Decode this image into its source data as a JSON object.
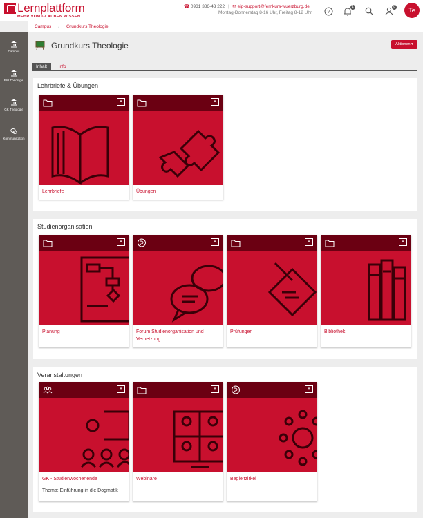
{
  "header": {
    "logo_title": "Lernplattform",
    "logo_subtitle": "MEHR VOM GLAUBEN WISSEN",
    "phone": "0931 386-43 222",
    "email": "eip-support@fernkurs-wuerzburg.de",
    "hours": "Montag-Donnerstag 8-16 Uhr, Freitag 8-12 Uhr",
    "notification_count": "1",
    "contacts_count": "0",
    "user_initials": "Te"
  },
  "breadcrumb": {
    "items": [
      "Campus",
      "Grundkurs Theologie"
    ]
  },
  "sidebar": {
    "items": [
      {
        "label": "Campus",
        "icon": "institution-icon"
      },
      {
        "label": "BW Theologie",
        "icon": "institution-icon"
      },
      {
        "label": "GK Theologie",
        "icon": "institution-icon"
      },
      {
        "label": "Kommunikation",
        "icon": "chat-icon"
      }
    ]
  },
  "page": {
    "title": "Grundkurs Theologie",
    "actions_label": "Aktionen",
    "tabs": [
      {
        "label": "Inhalt",
        "active": true
      },
      {
        "label": "info",
        "active": false
      }
    ]
  },
  "sections": [
    {
      "title": "Lehrbriefe & Übungen",
      "cards": [
        {
          "label": "Lehrbriefe",
          "type": "folder-icon",
          "image": "book"
        },
        {
          "label": "Übungen",
          "type": "folder-icon",
          "image": "puzzle"
        }
      ]
    },
    {
      "title": "Studienorganisation",
      "cards": [
        {
          "label": "Planung",
          "type": "folder-icon",
          "image": "flowchart"
        },
        {
          "label": "Forum Studienorganisation und Vernetzung",
          "type": "forum-icon",
          "image": "chat"
        },
        {
          "label": "Prüfungen",
          "type": "folder-icon",
          "image": "exam"
        },
        {
          "label": "Bibliothek",
          "type": "folder-icon",
          "image": "books"
        }
      ]
    },
    {
      "title": "Veranstaltungen",
      "cards": [
        {
          "label": "GK - Studienwochenende",
          "type": "group-icon",
          "image": "presentation",
          "description": "Thema: Einführung in die Dogmatik"
        },
        {
          "label": "Webinare",
          "type": "folder-icon",
          "image": "webinar"
        },
        {
          "label": "Begleitzirkel",
          "type": "forum-icon",
          "image": "circle"
        }
      ]
    }
  ],
  "colors": {
    "brand": "#c8102e",
    "card_header": "#6b0012",
    "sidebar": "#5f5b57"
  }
}
